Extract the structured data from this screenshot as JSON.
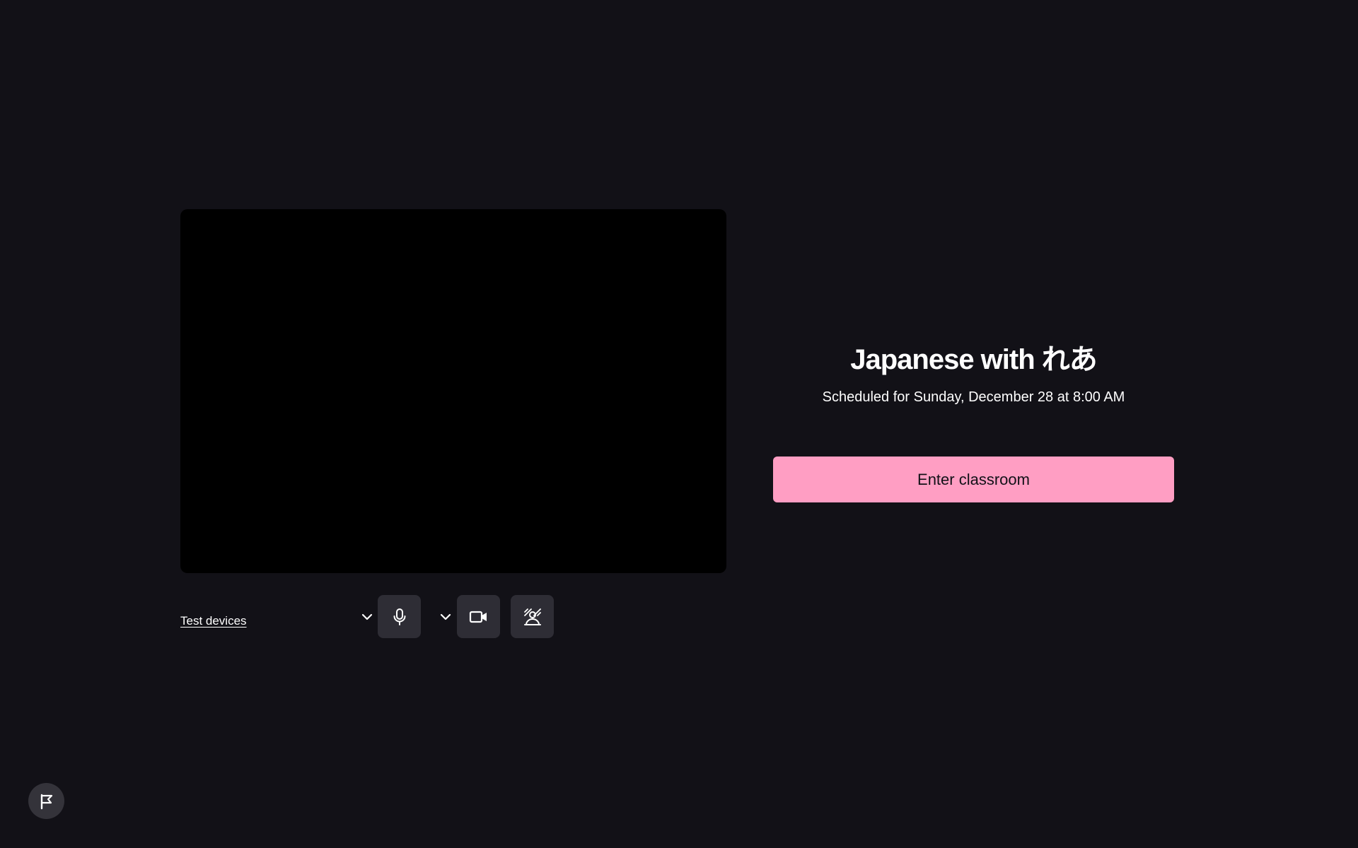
{
  "lesson": {
    "title": "Japanese with れあ",
    "schedule": "Scheduled for Sunday, December 28 at 8:00 AM"
  },
  "actions": {
    "enter_label": "Enter classroom"
  },
  "controls": {
    "test_devices_label": "Test devices",
    "icons": [
      "chevron-down-icon",
      "microphone-icon",
      "camera-icon",
      "background-effects-icon",
      "flag-icon"
    ]
  },
  "colors": {
    "background": "#121117",
    "accent": "#ff9ec3",
    "control_button": "#2e2d35",
    "video_preview": "#000000"
  }
}
